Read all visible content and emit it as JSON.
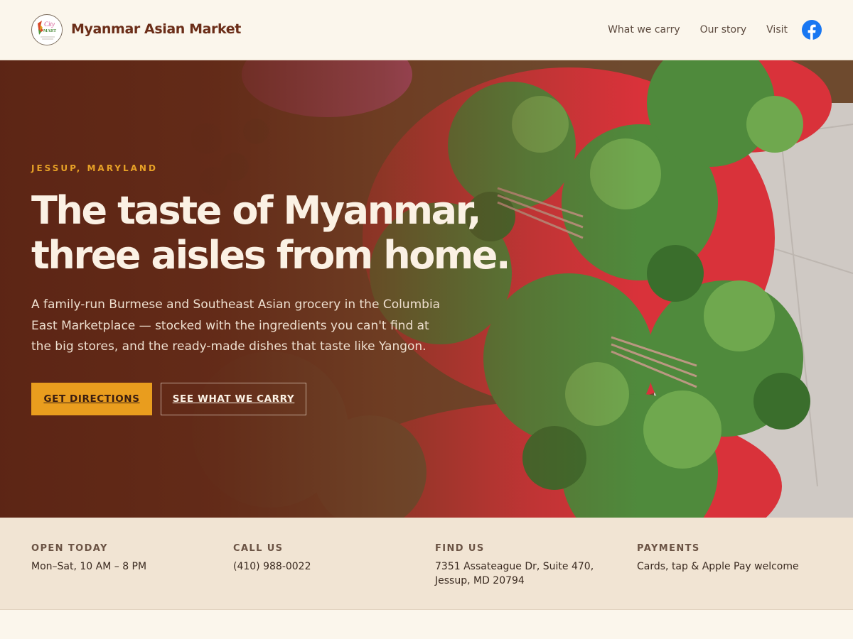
{
  "header": {
    "brand": "Myanmar Asian Market",
    "logo_text": "City MART",
    "nav": [
      "What we carry",
      "Our story",
      "Visit"
    ],
    "facebook_icon": "facebook-icon"
  },
  "hero": {
    "eyebrow": "JESSUP, MARYLAND",
    "headline_line1": "The taste of Myanmar,",
    "headline_line2": "three aisles from home.",
    "lede": "A family-run Burmese and Southeast Asian grocery in the Columbia East Marketplace — stocked with the ingredients you can't find at the big stores, and the ready-made dishes that taste like Yangon.",
    "primary_cta": "GET DIRECTIONS",
    "secondary_cta": "SEE WHAT WE CARRY"
  },
  "info": [
    {
      "label": "OPEN TODAY",
      "value": "Mon–Sat, 10 AM – 8 PM"
    },
    {
      "label": "CALL US",
      "value": "(410) 988-0022"
    },
    {
      "label": "FIND US",
      "value": "7351 Assateague Dr, Suite 470, Jessup, MD 20794"
    },
    {
      "label": "PAYMENTS",
      "value": "Cards, tap & Apple Pay welcome"
    }
  ],
  "colors": {
    "brand": "#6b2d18",
    "accent": "#e99d1e",
    "background": "#fbf6ec",
    "info_strip": "#f1e4d3",
    "facebook": "#1877f2"
  }
}
